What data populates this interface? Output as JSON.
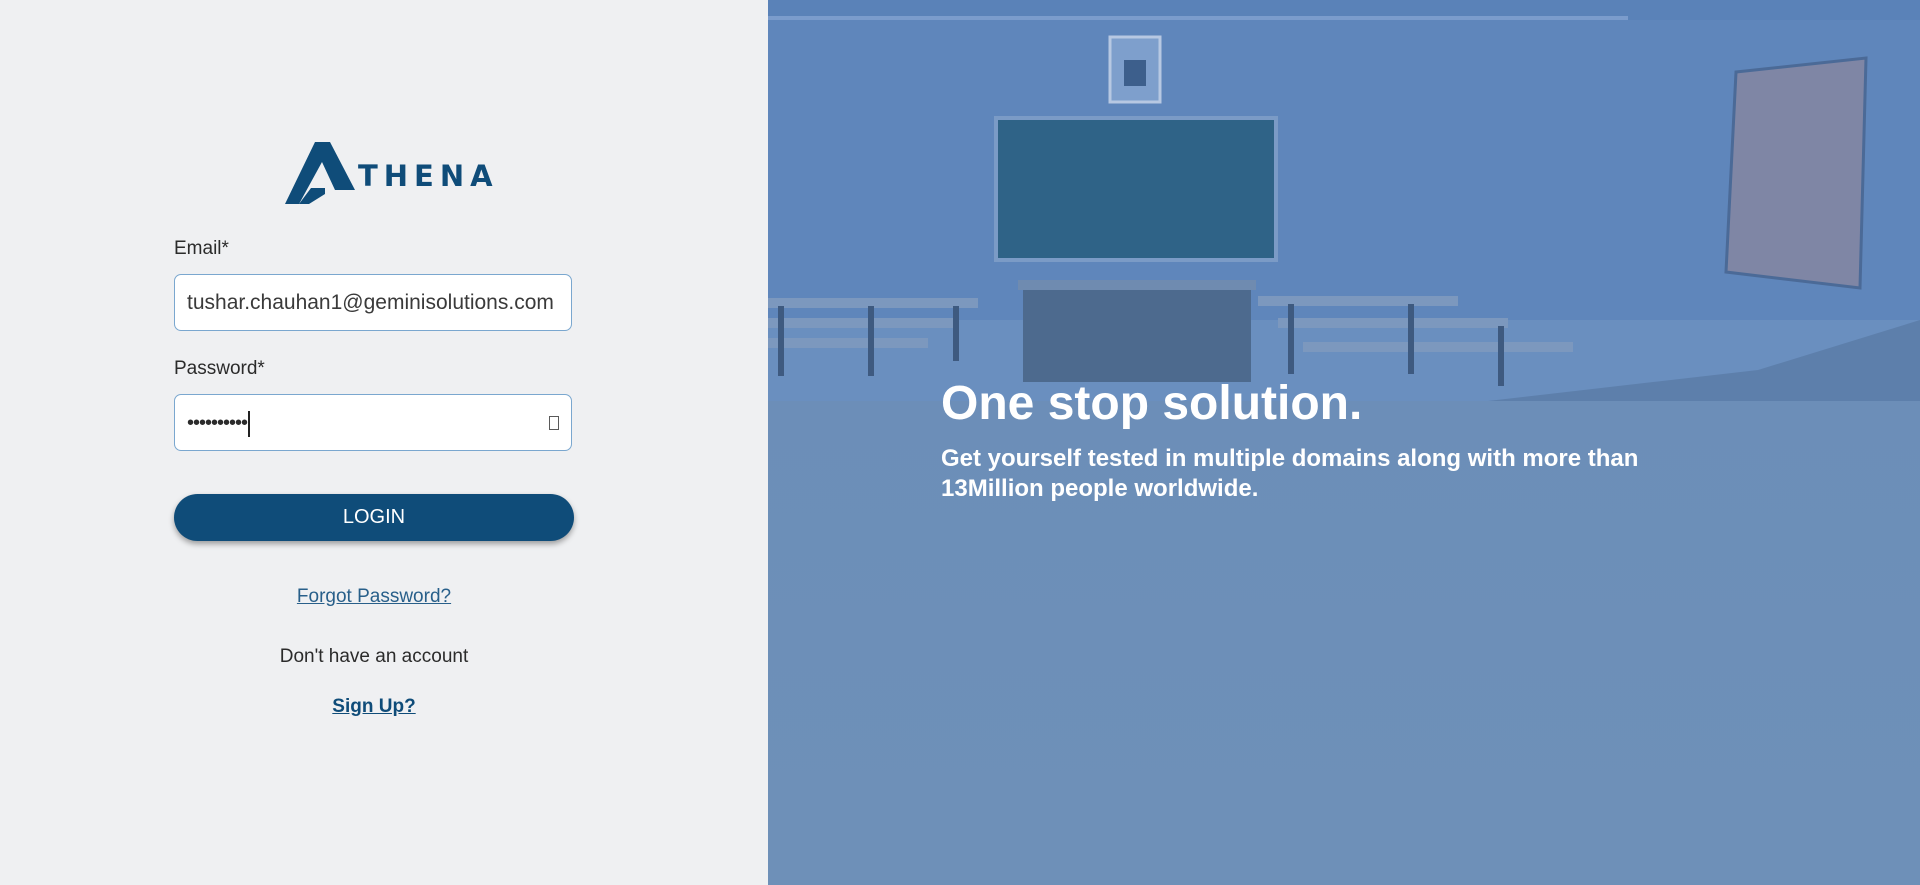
{
  "brand": {
    "logo_text": "THENA",
    "logo_icon": "athena-a-mark",
    "color": "#0f4c79"
  },
  "form": {
    "email_label": "Email*",
    "email_value": "tushar.chauhan1@geminisolutions.com",
    "password_label": "Password*",
    "password_masked": "••••••••••",
    "password_toggle_icon": "eye-icon",
    "login_label": "LOGIN",
    "forgot_label": "Forgot Password?",
    "no_account_text": "Don't have an account",
    "signup_label": "Sign Up?"
  },
  "hero": {
    "title": "One stop solution.",
    "subtitle": "Get yourself tested in multiple domains along with more than 13Million people worldwide.",
    "overlay_color": "#6a8db8"
  }
}
